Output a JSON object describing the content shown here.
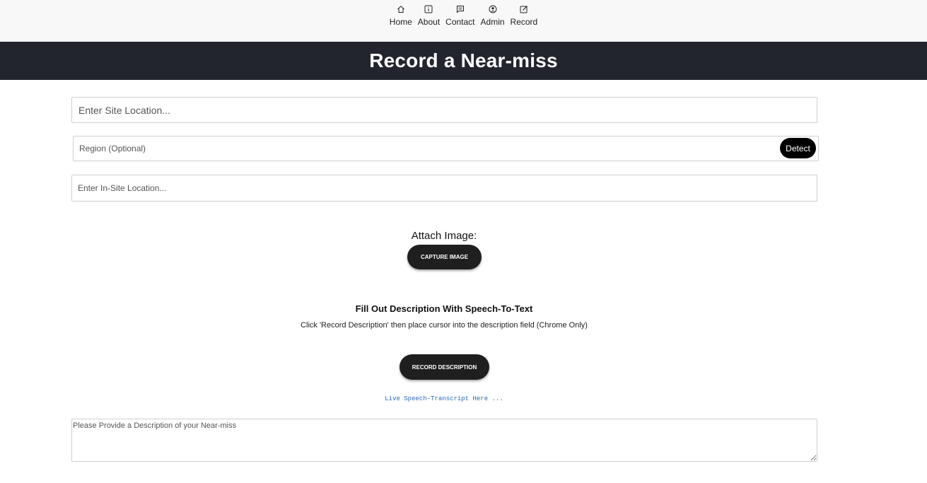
{
  "nav": {
    "items": [
      {
        "label": "Home",
        "icon": "home-icon"
      },
      {
        "label": "About",
        "icon": "info-icon"
      },
      {
        "label": "Contact",
        "icon": "message-icon"
      },
      {
        "label": "Admin",
        "icon": "user-circle-icon"
      },
      {
        "label": "Record",
        "icon": "edit-icon"
      }
    ]
  },
  "banner": {
    "title": "Record a Near-miss"
  },
  "form": {
    "site_placeholder": "Enter Site Location...",
    "region_placeholder": "Region (Optional)",
    "detect_label": "Detect",
    "insite_placeholder": "Enter In-Site Location...",
    "attach_label": "Attach Image:",
    "capture_label": "CAPTURE IMAGE",
    "speech_title": "Fill Out Description With Speech-To-Text",
    "speech_subtitle": "Click 'Record Description' then place cursor into the description field (Chrome Only)",
    "record_label": "RECORD DESCRIPTION",
    "transcript_placeholder": "Live Speech-Transcript Here ...",
    "description_placeholder": "Please Provide a Description of your Near-miss"
  },
  "colors": {
    "banner_bg": "#23252e",
    "button_bg": "#1f1f1f",
    "transcript": "#2b6cb0"
  }
}
